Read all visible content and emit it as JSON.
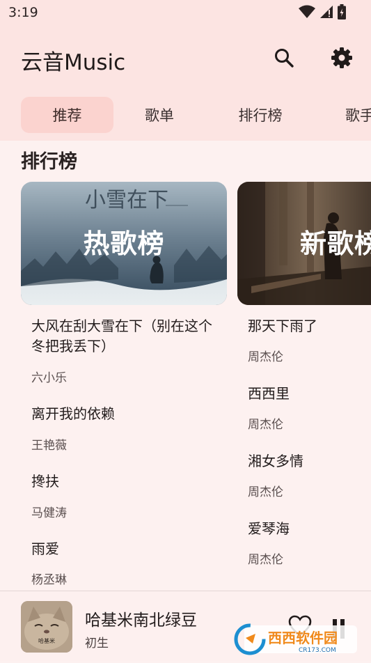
{
  "status": {
    "time": "3:19"
  },
  "app": {
    "title": "云音Music"
  },
  "tabs": [
    {
      "label": "推荐",
      "active": true
    },
    {
      "label": "歌单"
    },
    {
      "label": "排行榜"
    },
    {
      "label": "歌手"
    }
  ],
  "section": {
    "title": "排行榜"
  },
  "charts": [
    {
      "name": "热歌榜",
      "cover_text": "小雪在下",
      "songs": [
        {
          "title": "大风在刮大雪在下（别在这个冬把我丢下）",
          "artist": "六小乐"
        },
        {
          "title": "离开我的依赖",
          "artist": "王艳薇"
        },
        {
          "title": "搀扶",
          "artist": "马健涛"
        },
        {
          "title": "雨爱",
          "artist": "杨丞琳"
        }
      ]
    },
    {
      "name": "新歌榜",
      "songs": [
        {
          "title": "那天下雨了",
          "artist": "周杰伦"
        },
        {
          "title": "西西里",
          "artist": "周杰伦"
        },
        {
          "title": "湘女多情",
          "artist": "周杰伦"
        },
        {
          "title": "爱琴海",
          "artist": "周杰伦"
        }
      ]
    }
  ],
  "player": {
    "title": "哈基米南北绿豆",
    "artist": "初生",
    "cover_text": "哈基米"
  },
  "watermark": {
    "main": "西西软件园",
    "sub": "CR173.COM"
  },
  "colors": {
    "accent": "#fbd3cf",
    "header": "#fce4e2",
    "background": "#fdf1f0"
  },
  "icons": [
    "wifi-icon",
    "signal-icon",
    "battery-icon",
    "search-icon",
    "gear-icon",
    "heart-icon",
    "pause-icon"
  ]
}
